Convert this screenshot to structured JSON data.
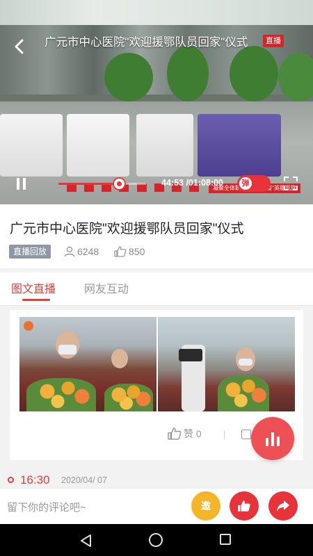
{
  "video": {
    "title": "广元市中心医院\"欢迎援鄂队员回家\"仪式",
    "live_badge": "直播",
    "banner_text": "凝聚全体职工 欢迎战\"疫\"英雄凯旋",
    "progress": 0.69,
    "time": "44:53 /01:08:00",
    "danmu_label": "弹"
  },
  "info": {
    "title": "广元市中心医院\"欢迎援鄂队员回家\"仪式",
    "tag": "直播回放",
    "viewers": "6248",
    "likes": "850"
  },
  "tabs": [
    {
      "label": "图文直播",
      "active": true
    },
    {
      "label": "网友互动",
      "active": false
    }
  ],
  "card": {
    "like_label": "赞 0"
  },
  "timeline": {
    "time": "16:30",
    "date": "2020/04/ 07"
  },
  "comment": {
    "placeholder": "留下你的评论吧~",
    "invite_label": "邀"
  },
  "colors": {
    "accent": "#e0403a",
    "live_red": "#d3262a",
    "invite_yellow": "#f5b52a"
  }
}
